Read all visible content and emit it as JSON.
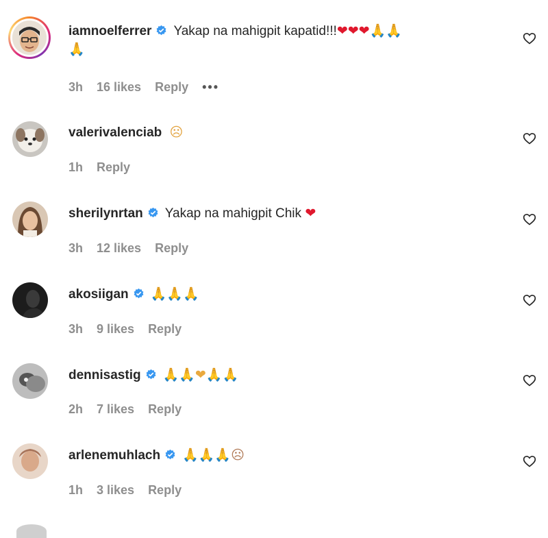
{
  "comments": [
    {
      "username": "iamnoelferrer",
      "verified": true,
      "text": "Yakap na mahigpit kapatid!!!",
      "emojis": "❤❤❤🙏🙏",
      "emojis2": "🙏",
      "time": "3h",
      "likes": "16 likes",
      "reply": "Reply",
      "more": "•••"
    },
    {
      "username": "valerivalenciab",
      "verified": false,
      "text": "",
      "emojis": "☹",
      "time": "1h",
      "likes": "",
      "reply": "Reply"
    },
    {
      "username": "sherilynrtan",
      "verified": true,
      "text": "Yakap na mahigpit Chik",
      "emojis": "❤",
      "time": "3h",
      "likes": "12 likes",
      "reply": "Reply"
    },
    {
      "username": "akosiigan",
      "verified": true,
      "text": "",
      "emojis": "🙏🙏🙏",
      "time": "3h",
      "likes": "9 likes",
      "reply": "Reply"
    },
    {
      "username": "dennisastig",
      "verified": true,
      "text": "",
      "emojis": "🙏🙏❤🙏🙏",
      "time": "2h",
      "likes": "7 likes",
      "reply": "Reply"
    },
    {
      "username": "arlenemuhlach",
      "verified": true,
      "text": "",
      "emojis": "🙏🙏🙏☹",
      "time": "1h",
      "likes": "3 likes",
      "reply": "Reply"
    }
  ],
  "colors": {
    "verified": "#3897f0",
    "meta": "#8e8e8e",
    "heart": "#e0182d"
  }
}
